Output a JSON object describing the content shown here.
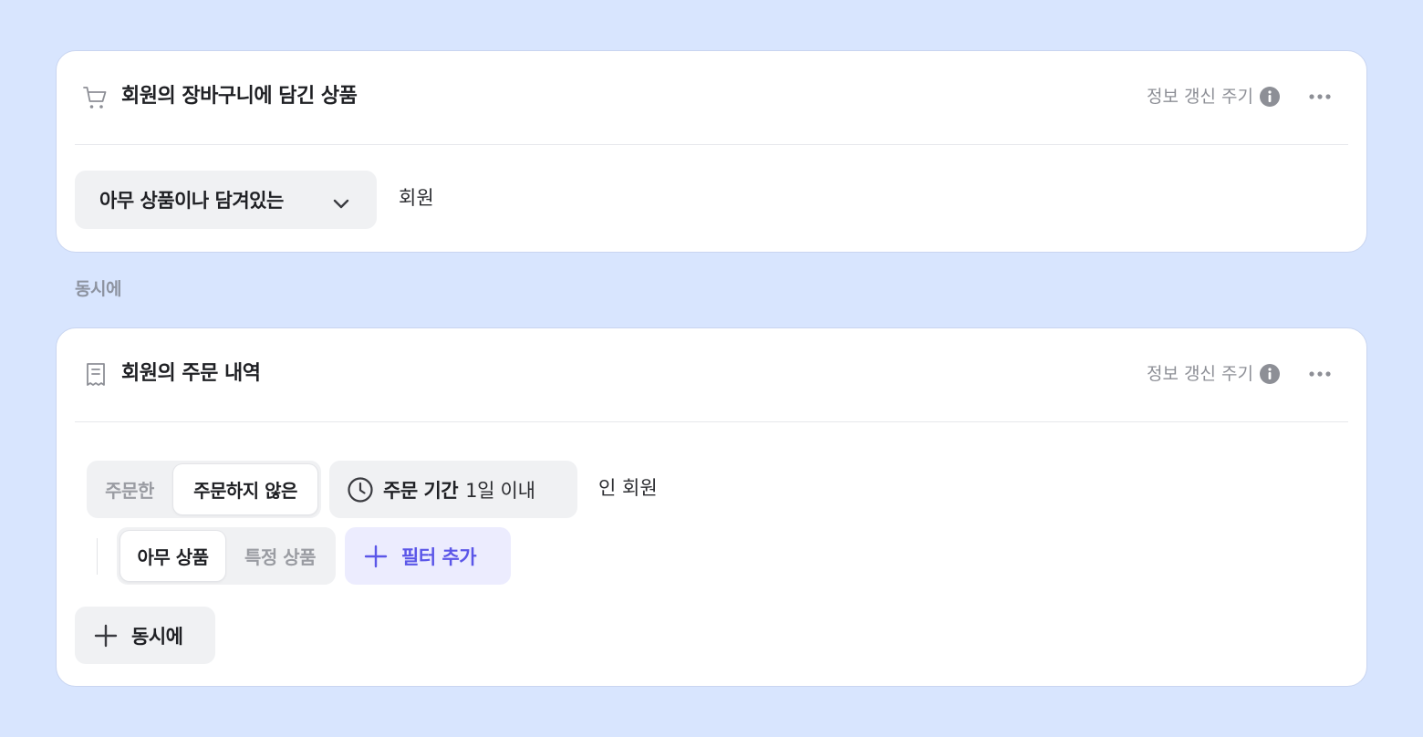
{
  "colors": {
    "background": "#d8e5fe",
    "card": "#ffffff",
    "accent": "#5b56e8",
    "accent_bg": "#ececfe",
    "muted_text": "#8d8f96",
    "chip_bg": "#f0f1f3"
  },
  "cart_card": {
    "icon": "shopping-cart-icon",
    "title": "회원의 장바구니에 담긴 상품",
    "refresh_label": "정보 갱신 주기",
    "refresh_icon": "info-icon",
    "more_icon": "more-horizontal-icon",
    "condition_select": "아무 상품이나 담겨있는",
    "suffix": "회원"
  },
  "connector_label": "동시에",
  "order_card": {
    "icon": "receipt-icon",
    "title": "회원의 주문 내역",
    "refresh_label": "정보 갱신 주기",
    "refresh_icon": "info-icon",
    "more_icon": "more-horizontal-icon",
    "order_toggle": {
      "options": [
        "주문한",
        "주문하지 않은"
      ],
      "selected": "주문하지 않은"
    },
    "period": {
      "icon": "clock-icon",
      "label": "주문 기간",
      "value": "1일 이내"
    },
    "suffix": "인 회원",
    "product_toggle": {
      "options": [
        "아무 상품",
        "특정 상품"
      ],
      "selected": "아무 상품"
    },
    "add_filter_label": "필터 추가",
    "add_and_label": "동시에"
  }
}
